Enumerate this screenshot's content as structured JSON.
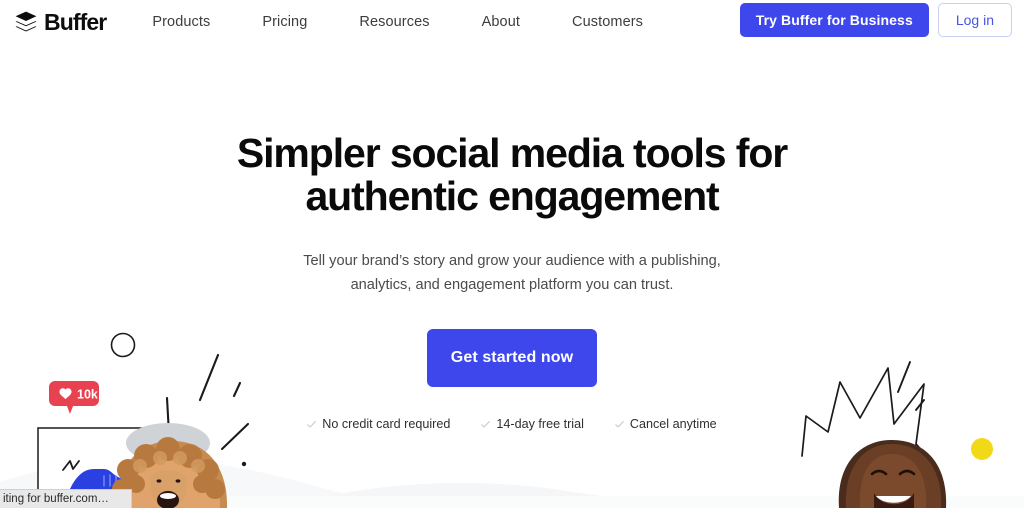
{
  "brand": {
    "name": "Buffer",
    "logo_icon": "stacked-layers-icon"
  },
  "nav": {
    "links": [
      {
        "label": "Products"
      },
      {
        "label": "Pricing"
      },
      {
        "label": "Resources"
      },
      {
        "label": "About"
      },
      {
        "label": "Customers"
      }
    ],
    "cta_primary": "Try Buffer for Business",
    "cta_secondary": "Log in"
  },
  "hero": {
    "headline_line1": "Simpler social media tools for",
    "headline_line2": "authentic engagement",
    "subhead_line1": "Tell your brand’s story and grow your audience with a publishing,",
    "subhead_line2": "analytics, and engagement platform you can trust.",
    "cta_label": "Get started now",
    "trust": [
      {
        "icon": "check-icon",
        "label": "No credit card required"
      },
      {
        "icon": "check-icon",
        "label": "14-day free trial"
      },
      {
        "icon": "check-icon",
        "label": "Cancel anytime"
      }
    ]
  },
  "illustration": {
    "like_badge": {
      "icon": "heart-icon",
      "count": "10k"
    },
    "photo_frame": "sneaker-photo-frame",
    "doodles": [
      "circle-outline",
      "radiating-lines",
      "starburst-zigzag",
      "yellow-dot"
    ]
  },
  "browser": {
    "status_text": "iting for buffer.com…"
  },
  "colors": {
    "brand_blue": "#3d47ec",
    "link_blue": "#4755e4",
    "badge_red": "#e8414f",
    "dot_yellow": "#f2d918",
    "sneaker_blue": "#2b40e0",
    "text_dark": "#0a0a0a",
    "text_muted": "#4b4b4b"
  }
}
